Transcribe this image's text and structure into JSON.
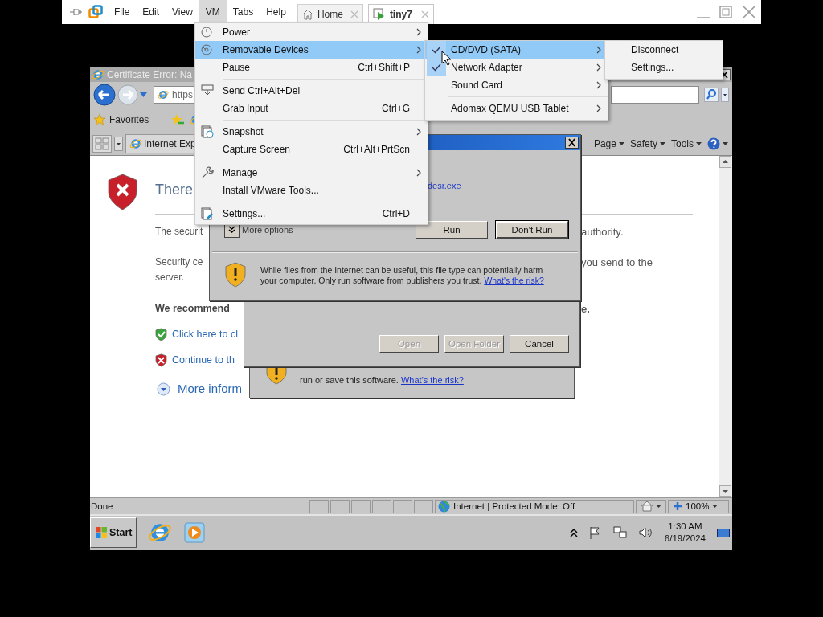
{
  "vmware": {
    "menus": [
      {
        "label": "File",
        "selected": false
      },
      {
        "label": "Edit",
        "selected": false
      },
      {
        "label": "View",
        "selected": false
      },
      {
        "label": "VM",
        "selected": true
      },
      {
        "label": "Tabs",
        "selected": false
      },
      {
        "label": "Help",
        "selected": false
      }
    ],
    "tabs": [
      {
        "label": "Home",
        "kind": "home",
        "selected": false
      },
      {
        "label": "tiny7",
        "kind": "vm",
        "selected": true
      }
    ]
  },
  "vm_menu": {
    "items": [
      {
        "kind": "item",
        "label": "Power",
        "submenu": true,
        "selected": false
      },
      {
        "kind": "item",
        "label": "Removable Devices",
        "submenu": true,
        "selected": true
      },
      {
        "kind": "item",
        "label": "Pause",
        "shortcut": "Ctrl+Shift+P",
        "submenu": false,
        "selected": false
      },
      {
        "kind": "separator"
      },
      {
        "kind": "item",
        "label": "Send Ctrl+Alt+Del",
        "submenu": false,
        "selected": false
      },
      {
        "kind": "item",
        "label": "Grab Input",
        "shortcut": "Ctrl+G",
        "submenu": false,
        "selected": false
      },
      {
        "kind": "separator"
      },
      {
        "kind": "item",
        "label": "Snapshot",
        "submenu": true,
        "selected": false
      },
      {
        "kind": "item",
        "label": "Capture Screen",
        "shortcut": "Ctrl+Alt+PrtScn",
        "submenu": false,
        "selected": false
      },
      {
        "kind": "separator"
      },
      {
        "kind": "item",
        "label": "Manage",
        "submenu": true,
        "selected": false
      },
      {
        "kind": "item",
        "label": "Install VMware Tools...",
        "submenu": false,
        "selected": false
      },
      {
        "kind": "separator"
      },
      {
        "kind": "item",
        "label": "Settings...",
        "shortcut": "Ctrl+D",
        "submenu": false,
        "selected": false
      }
    ]
  },
  "devices_menu": {
    "items": [
      {
        "kind": "item",
        "label": "CD/DVD (SATA)",
        "checked": true,
        "submenu": true,
        "selected": true
      },
      {
        "kind": "item",
        "label": "Network Adapter",
        "checked": true,
        "submenu": true,
        "selected": false
      },
      {
        "kind": "item",
        "label": "Sound Card",
        "checked": false,
        "submenu": true,
        "selected": false
      },
      {
        "kind": "separator"
      },
      {
        "kind": "item",
        "label": "Adomax QEMU USB Tablet",
        "checked": false,
        "submenu": true,
        "selected": false
      }
    ]
  },
  "cd_menu": {
    "items": [
      {
        "label": "Disconnect"
      },
      {
        "label": "Settings..."
      }
    ]
  },
  "browser": {
    "title": "Certificate Error: Na",
    "address": "https:",
    "favorites": "Favorites",
    "tab": "Internet Exp",
    "commands": [
      {
        "label": "Page"
      },
      {
        "label": "Safety"
      },
      {
        "label": "Tools"
      }
    ],
    "heading": "There",
    "paragraphs": [
      {
        "lines": [
          "The securit"
        ],
        "right": "authority."
      },
      {
        "lines": [
          "Security ce",
          "server."
        ],
        "right": "you send to the"
      }
    ],
    "recommend": {
      "left": "We recommend",
      "right": "e."
    },
    "options": [
      {
        "kind": "safe",
        "label": "Click here to cl"
      },
      {
        "kind": "unsafe",
        "label": "Continue to th"
      },
      {
        "kind": "more",
        "label": "More inform"
      }
    ],
    "status": {
      "text": "Done",
      "zone": "Internet | Protected Mode: Off",
      "zoom": "100%"
    }
  },
  "taskbar": {
    "start": "Start",
    "time": "1:30 AM",
    "date": "6/19/2024"
  },
  "run_dialog": {
    "link": "desr.exe",
    "more_options": "More options",
    "buttons": [
      {
        "label": "Run",
        "default": false
      },
      {
        "label": "Don't Run",
        "default": true
      }
    ],
    "warning": "While files from the Internet can be useful, this file type can potentially harm your computer. Only run software from publishers you trust.",
    "risk_link": "What's the risk?"
  },
  "download_dialog": {
    "buttons": [
      {
        "label": "Open",
        "disabled": true
      },
      {
        "label": "Open Folder",
        "disabled": true
      },
      {
        "label": "Cancel",
        "disabled": false
      }
    ]
  },
  "back_dialog": {
    "text": "run or save this software.",
    "risk_link": "What's the risk?"
  }
}
